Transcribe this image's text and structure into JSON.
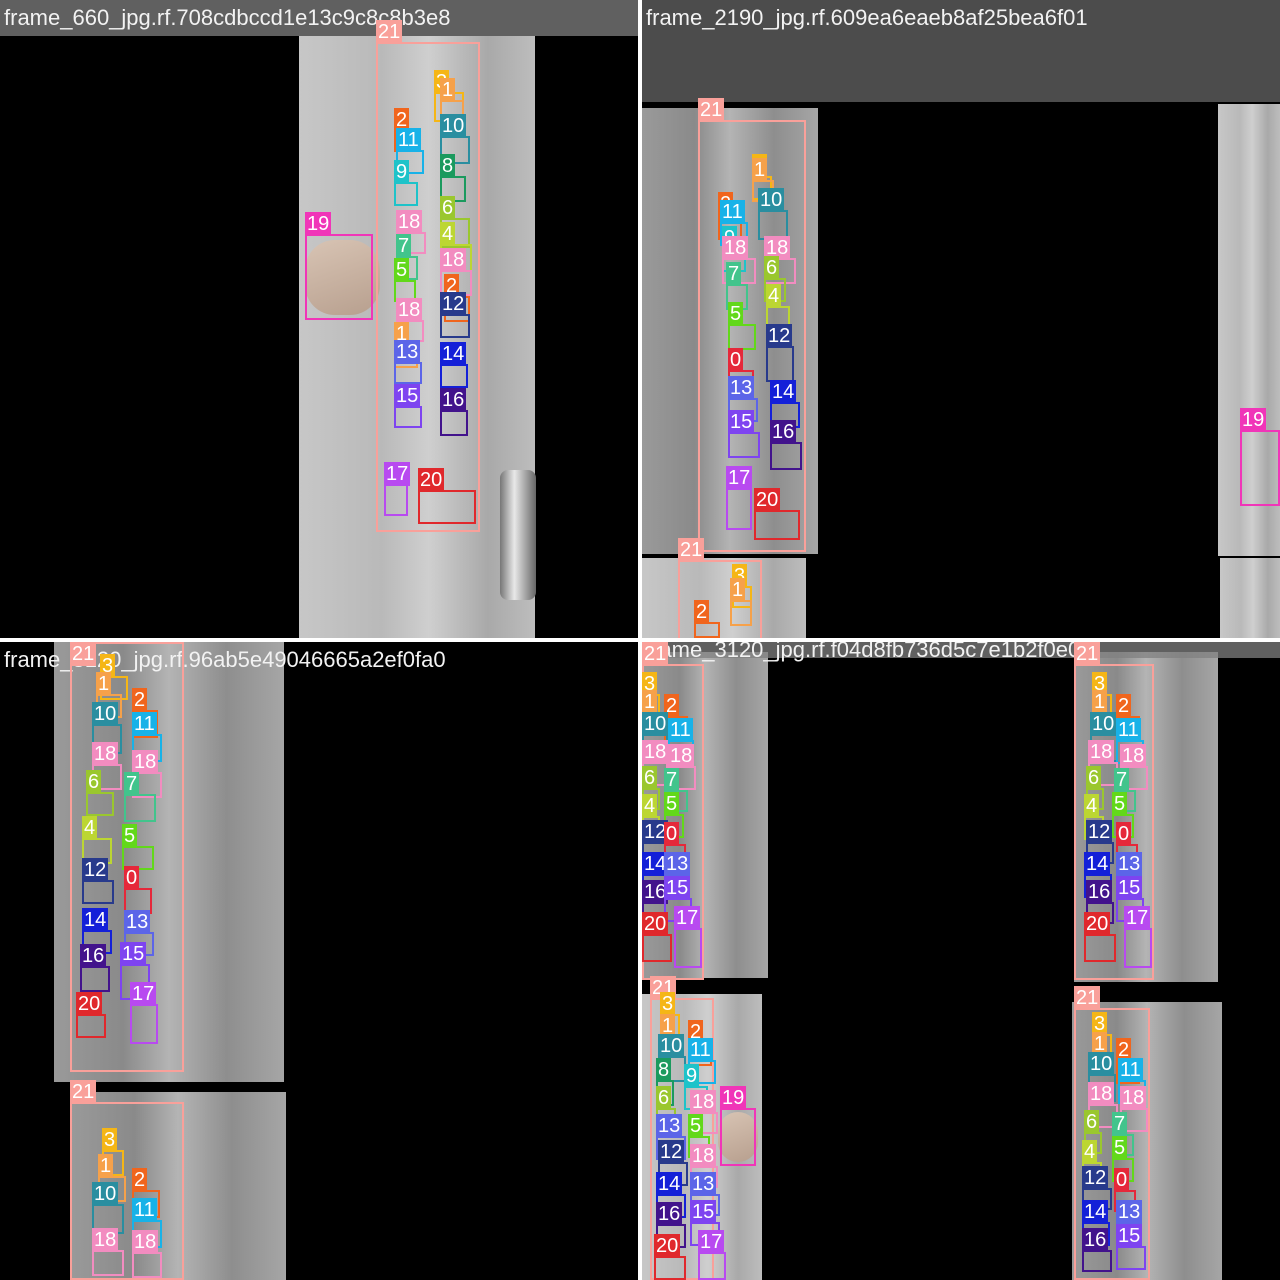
{
  "tiles": [
    {
      "title": "frame_660_jpg.rf.708cdbccd1e13c9c8c8b3e8"
    },
    {
      "title": "frame_2190_jpg.rf.609ea6eaeb8af25bea6f01"
    },
    {
      "title": "frame_3120_jpg.rf.96ab5e49046665a2ef0fa0"
    },
    {
      "title": "frame_3120_jpg.rf.f04d8fb736d5c7e1b2f0e0"
    }
  ],
  "class_labels": [
    "0",
    "1",
    "2",
    "3",
    "4",
    "5",
    "6",
    "7",
    "8",
    "9",
    "10",
    "11",
    "12",
    "13",
    "14",
    "15",
    "16",
    "17",
    "18",
    "19",
    "20",
    "21"
  ],
  "class_colors": {
    "0": "#e5283a",
    "1": "#f6a14a",
    "2": "#f0651d",
    "3": "#f5b616",
    "4": "#bcd632",
    "5": "#62d81a",
    "6": "#9ac72e",
    "7": "#42c48c",
    "8": "#1b9a5e",
    "9": "#1ec3c9",
    "10": "#2a8ea0",
    "11": "#18b2e8",
    "12": "#283a8c",
    "13": "#5c65e8",
    "14": "#1420d8",
    "15": "#7e44f0",
    "16": "#42138c",
    "17": "#b84af0",
    "18": "#f28cc0",
    "19": "#f035b8",
    "20": "#e0282c",
    "21": "#f9a09a"
  }
}
